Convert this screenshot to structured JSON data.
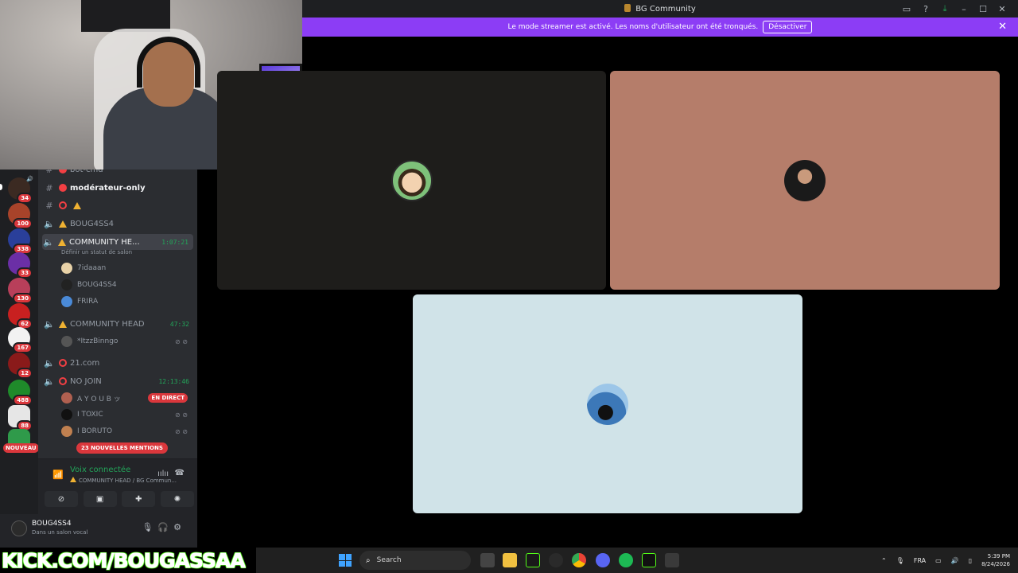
{
  "window": {
    "title": "BG Community"
  },
  "banner": {
    "text": "Le mode streamer est activé. Les noms d'utilisateur ont été tronqués.",
    "button": "Désactiver"
  },
  "servers": [
    {
      "badge": "34"
    },
    {
      "badge": "100"
    },
    {
      "badge": "338"
    },
    {
      "badge": "33"
    },
    {
      "badge": "130"
    },
    {
      "badge": "62"
    },
    {
      "badge": "167"
    },
    {
      "badge": "12"
    },
    {
      "badge": "488"
    },
    {
      "badge": "88"
    }
  ],
  "new_badge": "NOUVEAU",
  "channels": {
    "partial_top": "bot-cmd",
    "moderator": "modérateur-only",
    "voice1": "BOUG4SS4",
    "active_voice": {
      "name": "COMMUNITY HE...",
      "timer": "1:07:21",
      "subtext": "Définir un statut de salon"
    },
    "active_users": [
      "7idaaan",
      "BOUG4SS4",
      "FRIRA"
    ],
    "voice2": {
      "name": "COMMUNITY HEAD",
      "timer": "47:32"
    },
    "voice2_users": [
      "*ItzzBinngo"
    ],
    "voice3": "21.com",
    "voice4": {
      "name": "NO JOIN",
      "timer": "12:13:46"
    },
    "voice4_users": [
      {
        "name": "A Y O U B ッ",
        "live": "EN DIRECT"
      },
      {
        "name": "I TOXIC"
      },
      {
        "name": "I BORUTO"
      }
    ],
    "mentions": "23 NOUVELLES MENTIONS"
  },
  "voice_panel": {
    "title": "Voix connectée",
    "subtitle": "COMMUNITY HEAD / BG Commun..."
  },
  "user_panel": {
    "name": "BOUG4SS4",
    "status": "Dans un salon vocal"
  },
  "overlay": {
    "kick": "KICK.COM/BOUGASSAA"
  },
  "taskbar": {
    "search": "Search",
    "lang": "FRA",
    "time": "5:39 PM",
    "date": "8/24/2026"
  },
  "colors": {
    "accent": "#8c3df5",
    "online": "#23a55a",
    "danger": "#da373c"
  }
}
